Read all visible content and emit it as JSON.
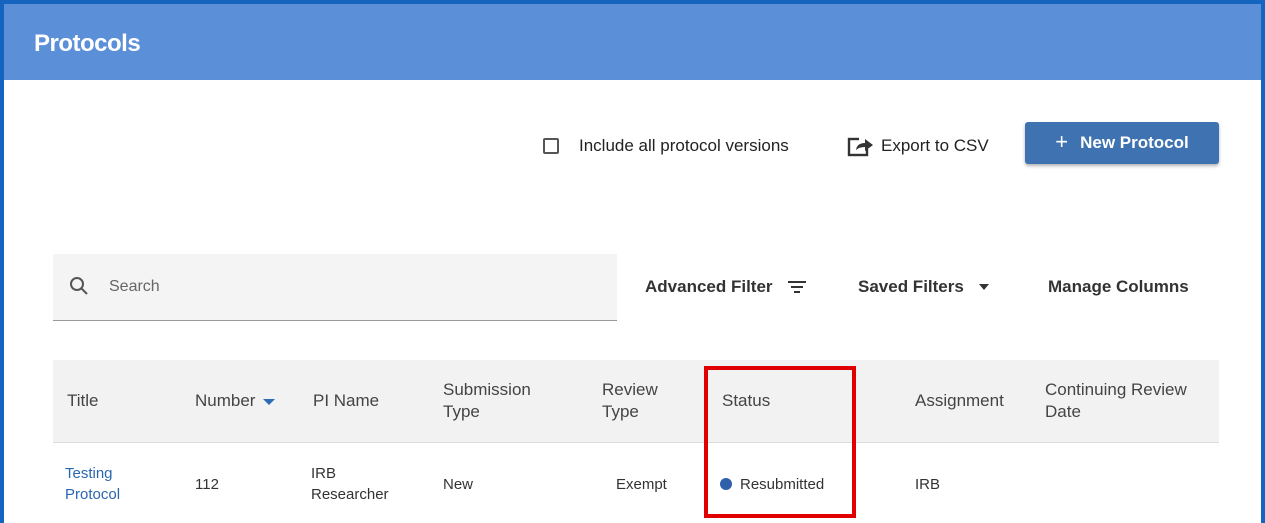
{
  "header": {
    "title": "Protocols"
  },
  "toolbar": {
    "include_versions_label": "Include all protocol versions",
    "include_versions_checked": false,
    "export_label": "Export to CSV",
    "new_protocol_label": "New Protocol",
    "new_protocol_icon": "plus-icon"
  },
  "search": {
    "placeholder": "Search",
    "value": ""
  },
  "filters": {
    "advanced_filter": "Advanced Filter",
    "saved_filters": "Saved Filters",
    "manage_columns": "Manage Columns"
  },
  "table": {
    "columns": {
      "title": "Title",
      "number": "Number",
      "pi_name": "PI Name",
      "submission_type": "Submission Type",
      "review_type": "Review Type",
      "status": "Status",
      "assignment": "Assignment",
      "continuing_review_date": "Continuing Review Date"
    },
    "sort_column": "number",
    "rows": [
      {
        "title": "Testing Protocol",
        "number": "112",
        "pi_name": "IRB Researcher",
        "submission_type": "New",
        "review_type": "Exempt",
        "status": "Resubmitted",
        "assignment": "IRB",
        "continuing_review_date": ""
      }
    ]
  },
  "colors": {
    "header_bg": "#5b8fd8",
    "frame_border": "#1565c0",
    "primary_button": "#3f72b0",
    "link": "#2b66b0",
    "status_dot": "#2f5fa9",
    "highlight": "#e00000"
  }
}
